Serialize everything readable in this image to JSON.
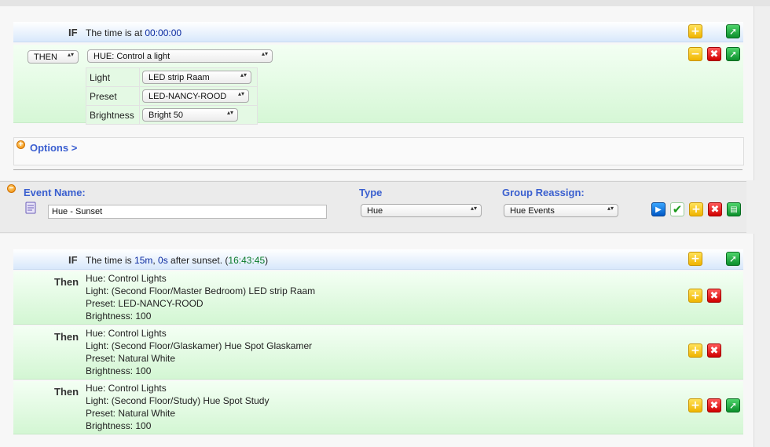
{
  "rule1": {
    "if_label": "IF",
    "if_prefix": "The time is at ",
    "if_time": "00:00:00",
    "then_select": "THEN",
    "action_select": "HUE: Control a light",
    "params": [
      {
        "label": "Light",
        "value": "LED strip Raam"
      },
      {
        "label": "Preset",
        "value": "LED-NANCY-ROOD"
      },
      {
        "label": "Brightness",
        "value": "Bright 50"
      }
    ],
    "options_label": "Options >"
  },
  "event": {
    "name_header": "Event Name:",
    "type_header": "Type",
    "group_header": "Group Reassign:",
    "name_value": "Hue - Sunset",
    "type_value": "Hue",
    "group_value": "Hue Events"
  },
  "rule2": {
    "if_label": "IF",
    "if_prefix": "The time is ",
    "if_offset_min": "15m",
    "if_sep": ", ",
    "if_offset_sec": "0s",
    "if_suffix": " after sunset. (",
    "if_clock": "16:43:45",
    "if_close": ")",
    "actions": [
      {
        "then_label": "Then",
        "lines": [
          "Hue: Control Lights",
          "Light: (Second Floor/Master Bedroom) LED strip Raam",
          "Preset: LED-NANCY-ROOD",
          "Brightness: 100"
        ]
      },
      {
        "then_label": "Then",
        "lines": [
          "Hue: Control Lights",
          "Light: (Second Floor/Glaskamer) Hue Spot Glaskamer",
          "Preset: Natural White",
          "Brightness: 100"
        ]
      },
      {
        "then_label": "Then",
        "lines": [
          "Hue: Control Lights",
          "Light: (Second Floor/Study) Hue Spot Study",
          "Preset: Natural White",
          "Brightness: 100"
        ]
      }
    ]
  },
  "icons": {
    "add": "+",
    "remove": "−",
    "delete": "✖",
    "go": "➚",
    "play": "▶",
    "check": "✔",
    "sheet": "▤",
    "expand": "+",
    "collapse": "−",
    "select_arrows": "▴▾"
  },
  "colors": {
    "accent_blue": "#3a5fcf",
    "if_bar": "#d8e8fb",
    "then_green": "#d6f7d6"
  }
}
